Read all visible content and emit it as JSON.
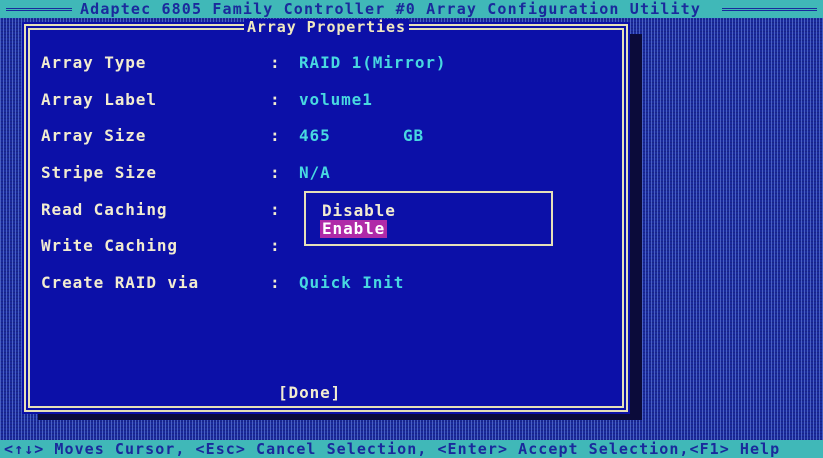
{
  "window": {
    "title": "Adaptec 6805 Family Controller #0 Array Configuration Utility"
  },
  "dialog": {
    "title": "Array Properties",
    "properties": [
      {
        "label": "Array Type",
        "colon": ":",
        "value": "RAID 1(Mirror)",
        "unit": ""
      },
      {
        "label": "Array Label",
        "colon": ":",
        "value": "volume1",
        "unit": ""
      },
      {
        "label": "Array Size",
        "colon": ":",
        "value": "465",
        "unit": "GB"
      },
      {
        "label": "Stripe Size",
        "colon": ":",
        "value": "N/A",
        "unit": ""
      },
      {
        "label": "Read Caching",
        "colon": ":",
        "value": "",
        "unit": ""
      },
      {
        "label": "Write Caching",
        "colon": ":",
        "value": "",
        "unit": ""
      },
      {
        "label": "Create RAID via",
        "colon": ":",
        "value": "Quick Init",
        "unit": ""
      }
    ],
    "popup": {
      "options": [
        "Disable",
        "Enable"
      ],
      "selected": "Enable"
    },
    "done_label": "[Done]"
  },
  "statusbar": {
    "text": "<↑↓> Moves Cursor, <Esc> Cancel Selection, <Enter> Accept Selection,<F1> Help"
  },
  "colors": {
    "background": "#1a2a9c",
    "bar": "#40b8b8",
    "dialog": "#0c10a8",
    "label_text": "#f2ecd0",
    "value_text": "#48d8e0",
    "highlight": "#b02aa8"
  }
}
